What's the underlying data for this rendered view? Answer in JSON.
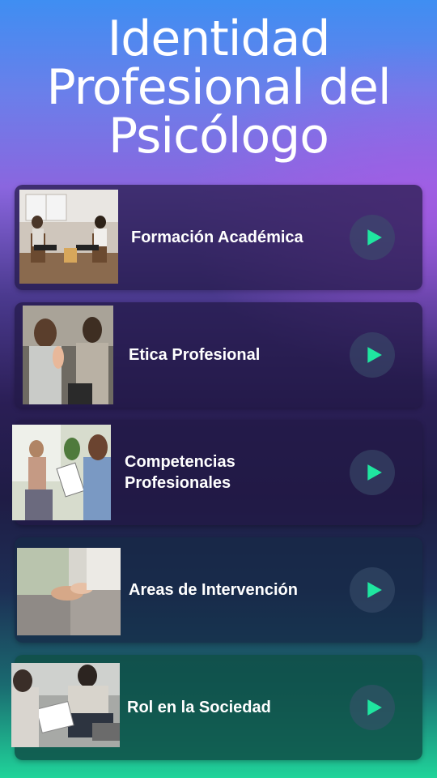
{
  "title": "Identidad Profesional del Psicólogo",
  "accent_color": "#1fe6a0",
  "items": [
    {
      "label": "Formación Académica",
      "icon": "play-icon"
    },
    {
      "label": "Etica Profesional",
      "icon": "play-icon"
    },
    {
      "label": "Competencias Profesionales",
      "icon": "play-icon"
    },
    {
      "label": "Areas de Intervención",
      "icon": "play-icon"
    },
    {
      "label": "Rol en la Sociedad",
      "icon": "play-icon"
    }
  ]
}
